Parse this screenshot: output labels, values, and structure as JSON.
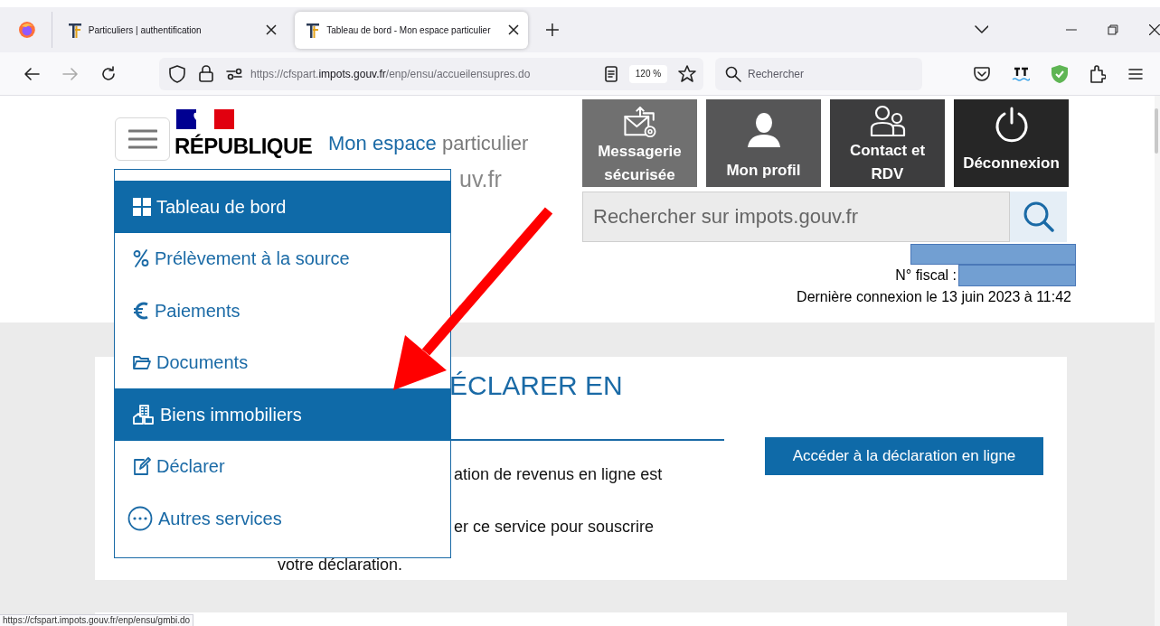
{
  "browser": {
    "tabs": [
      {
        "title": "Particuliers | authentification",
        "selected": false
      },
      {
        "title": "Tableau de bord - Mon espace particulier",
        "selected": true
      }
    ],
    "url": {
      "prefix": "https://cfspart.",
      "domain": "impots.gouv.fr",
      "path": "/enp/ensu/accueilensupres.do"
    },
    "zoom": "120 %",
    "search_placeholder": "Rechercher",
    "status_url": "https://cfspart.impots.gouv.fr/enp/ensu/gmbi.do"
  },
  "header": {
    "logo_line1": "RÉPUBLIQUE",
    "title_primary": "Mon espace",
    "title_secondary": "particulier",
    "domain_fragment": "uv.fr",
    "tiles": [
      {
        "kind": "mail",
        "label": "Messagerie sécurisée"
      },
      {
        "kind": "profile",
        "label": "Mon profil"
      },
      {
        "kind": "contact",
        "label": "Contact et RDV"
      },
      {
        "kind": "logout",
        "label": "Déconnexion"
      }
    ],
    "search_placeholder": "Rechercher sur impots.gouv.fr",
    "fiscal_label": "N° fiscal :",
    "last_login": "Dernière connexion le 13 juin 2023 à 11:42"
  },
  "menu": {
    "items": [
      {
        "kind": "dashboard",
        "label": "Tableau de bord",
        "selected": true
      },
      {
        "kind": "percent",
        "label": "Prélèvement à la source",
        "selected": false
      },
      {
        "kind": "euro",
        "label": "Paiements",
        "selected": false
      },
      {
        "kind": "folder",
        "label": "Documents",
        "selected": false
      },
      {
        "kind": "buildings",
        "label": "Biens immobiliers",
        "selected": true
      },
      {
        "kind": "edit",
        "label": "Déclarer",
        "selected": false
      },
      {
        "kind": "more",
        "label": "Autres services",
        "selected": false
      }
    ]
  },
  "card": {
    "heading": "ÉCLARER EN",
    "lines": [
      "ation de revenus en ligne est",
      "er ce service pour souscrire",
      "votre déclaration."
    ],
    "button": "Accéder à la déclaration en ligne"
  }
}
